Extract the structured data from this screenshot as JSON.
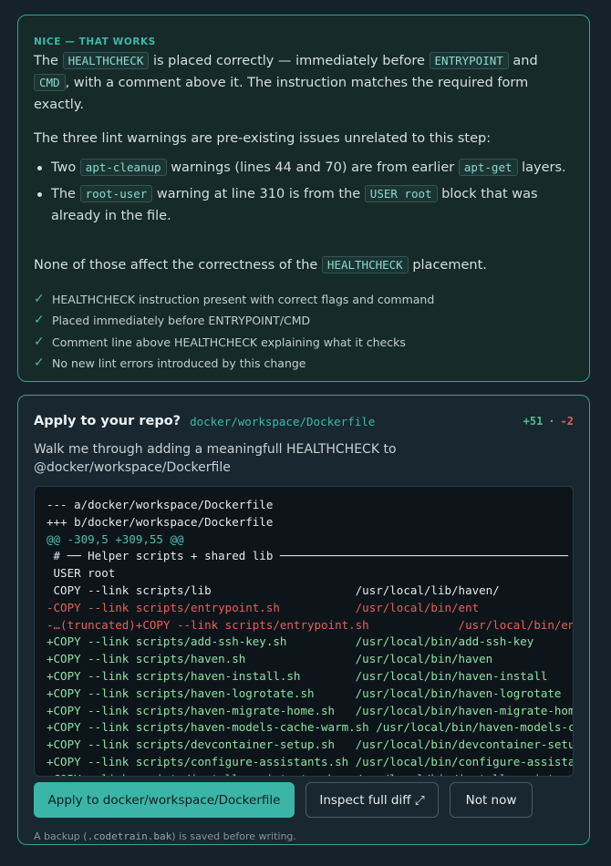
{
  "result_card": {
    "eyebrow": "NICE — THAT WORKS",
    "p1": {
      "t1": "The ",
      "c1": "HEALTHCHECK",
      "t2": " is placed correctly — immediately before ",
      "c2": "ENTRYPOINT",
      "t3": " and ",
      "c3": "CMD",
      "t4": ", with a comment above it. The instruction matches the required form exactly."
    },
    "p2": "The three lint warnings are pre-existing issues unrelated to this step:",
    "bullets": [
      {
        "t1": "Two ",
        "c1": "apt-cleanup",
        "t2": " warnings (lines 44 and 70) are from earlier ",
        "c2": "apt-get",
        "t3": " layers."
      },
      {
        "t1": "The ",
        "c1": "root-user",
        "t2": " warning at line 310 is from the ",
        "c2": "USER root",
        "t3": " block that was already in the file."
      }
    ],
    "p3": {
      "t1": "None of those affect the correctness of the ",
      "c1": "HEALTHCHECK",
      "t2": " placement."
    },
    "checks": [
      "HEALTHCHECK instruction present with correct flags and command",
      "Placed immediately before ENTRYPOINT/CMD",
      "Comment line above HEALTHCHECK explaining what it checks",
      "No new lint errors introduced by this change"
    ]
  },
  "apply_card": {
    "title": "Apply to your repo?",
    "path": "docker/workspace/Dockerfile",
    "additions": "+51",
    "separator": "·",
    "deletions": "-2",
    "prompt": "Walk me through adding a meaningfull HEALTHCHECK to @docker/workspace/Dockerfile",
    "diff_lines": [
      {
        "type": "meta",
        "text": "--- a/docker/workspace/Dockerfile"
      },
      {
        "type": "meta",
        "text": "+++ b/docker/workspace/Dockerfile"
      },
      {
        "type": "hunk",
        "text": "@@ -309,5 +309,55 @@"
      },
      {
        "type": "ctx",
        "text": " # ── Helper scripts + shared lib ──────────────────────────────────────────"
      },
      {
        "type": "ctx",
        "text": " USER root"
      },
      {
        "type": "ctx",
        "text": " COPY --link scripts/lib                     /usr/local/lib/haven/"
      },
      {
        "type": "del",
        "text": "-COPY --link scripts/entrypoint.sh           /usr/local/bin/ent"
      },
      {
        "type": "del",
        "text": "-…(truncated)+COPY --link scripts/entrypoint.sh             /usr/local/bin/entrypoint.sh"
      },
      {
        "type": "add",
        "text": "+COPY --link scripts/add-ssh-key.sh          /usr/local/bin/add-ssh-key"
      },
      {
        "type": "add",
        "text": "+COPY --link scripts/haven.sh                /usr/local/bin/haven"
      },
      {
        "type": "add",
        "text": "+COPY --link scripts/haven-install.sh        /usr/local/bin/haven-install"
      },
      {
        "type": "add",
        "text": "+COPY --link scripts/haven-logrotate.sh      /usr/local/bin/haven-logrotate"
      },
      {
        "type": "add",
        "text": "+COPY --link scripts/haven-migrate-home.sh   /usr/local/bin/haven-migrate-home"
      },
      {
        "type": "add",
        "text": "+COPY --link scripts/haven-models-cache-warm.sh /usr/local/bin/haven-models-cache-warm"
      },
      {
        "type": "add",
        "text": "+COPY --link scripts/devcontainer-setup.sh   /usr/local/bin/devcontainer-setup"
      },
      {
        "type": "add",
        "text": "+COPY --link scripts/configure-assistants.sh /usr/local/bin/configure-assistants"
      },
      {
        "type": "add",
        "text": "+COPY --link scripts/install-assistants.sh   /usr/local/bin/install-assistants"
      }
    ],
    "buttons": {
      "apply": "Apply to docker/workspace/Dockerfile",
      "inspect": "Inspect full diff ⤢",
      "not_now": "Not now"
    },
    "footnote": {
      "t1": "A backup (",
      "c1": ".codetrain.bak",
      "t2": ") is saved before writing."
    }
  },
  "colors": {
    "accent": "#3bb5a7",
    "added": "#4cc08a",
    "removed": "#e0605c"
  }
}
